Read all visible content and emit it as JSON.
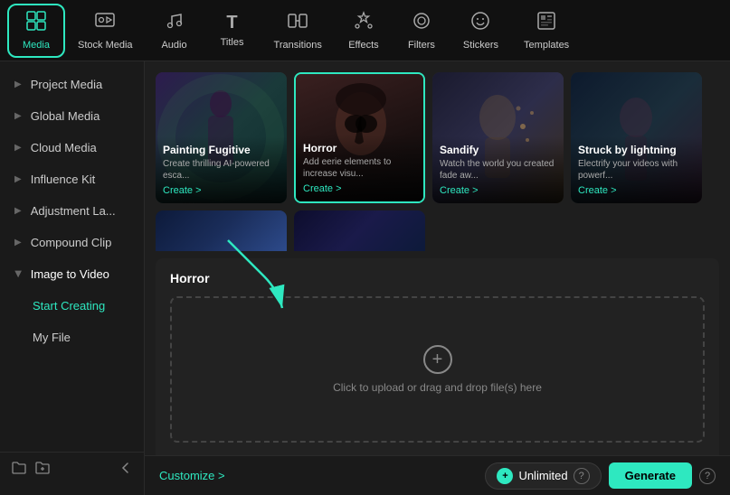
{
  "nav": {
    "items": [
      {
        "id": "media",
        "label": "Media",
        "icon": "⊞",
        "active": true
      },
      {
        "id": "stock-media",
        "label": "Stock Media",
        "icon": "🎬"
      },
      {
        "id": "audio",
        "label": "Audio",
        "icon": "♪"
      },
      {
        "id": "titles",
        "label": "Titles",
        "icon": "T"
      },
      {
        "id": "transitions",
        "label": "Transitions",
        "icon": "▶"
      },
      {
        "id": "effects",
        "label": "Effects",
        "icon": "✦"
      },
      {
        "id": "filters",
        "label": "Filters",
        "icon": "◎"
      },
      {
        "id": "stickers",
        "label": "Stickers",
        "icon": "✿"
      },
      {
        "id": "templates",
        "label": "Templates",
        "icon": "⊟"
      }
    ]
  },
  "sidebar": {
    "items": [
      {
        "id": "project-media",
        "label": "Project Media",
        "hasArrow": true
      },
      {
        "id": "global-media",
        "label": "Global Media",
        "hasArrow": true
      },
      {
        "id": "cloud-media",
        "label": "Cloud Media",
        "hasArrow": true
      },
      {
        "id": "influence-kit",
        "label": "Influence Kit",
        "hasArrow": true
      },
      {
        "id": "adjustment-la",
        "label": "Adjustment La...",
        "hasArrow": true
      },
      {
        "id": "compound-clip",
        "label": "Compound Clip",
        "hasArrow": true
      },
      {
        "id": "image-to-video",
        "label": "Image to Video",
        "hasArrow": true,
        "expanded": true
      }
    ],
    "subitems": [
      {
        "id": "start-creating",
        "label": "Start Creating",
        "active": true
      },
      {
        "id": "my-file",
        "label": "My File"
      }
    ]
  },
  "thumbnails": [
    {
      "id": "painting-fugitive",
      "title": "Painting Fugitive",
      "desc": "Create thrilling AI-powered esca...",
      "createLabel": "Create >"
    },
    {
      "id": "horror",
      "title": "Horror",
      "desc": "Add eerie elements to increase visu...",
      "createLabel": "Create >",
      "selected": true
    },
    {
      "id": "sandify",
      "title": "Sandify",
      "desc": "Watch the world you created fade aw...",
      "createLabel": "Create >"
    },
    {
      "id": "struck-by-lightning",
      "title": "Struck by lightning",
      "desc": "Electrify your videos with powerf...",
      "createLabel": "Create >"
    }
  ],
  "panel": {
    "title": "Horror",
    "upload_text": "Click to upload or drag and drop file(s) here"
  },
  "footer": {
    "customize_label": "Customize >",
    "unlimited_label": "Unlimited",
    "generate_label": "Generate",
    "help_icon": "?"
  }
}
